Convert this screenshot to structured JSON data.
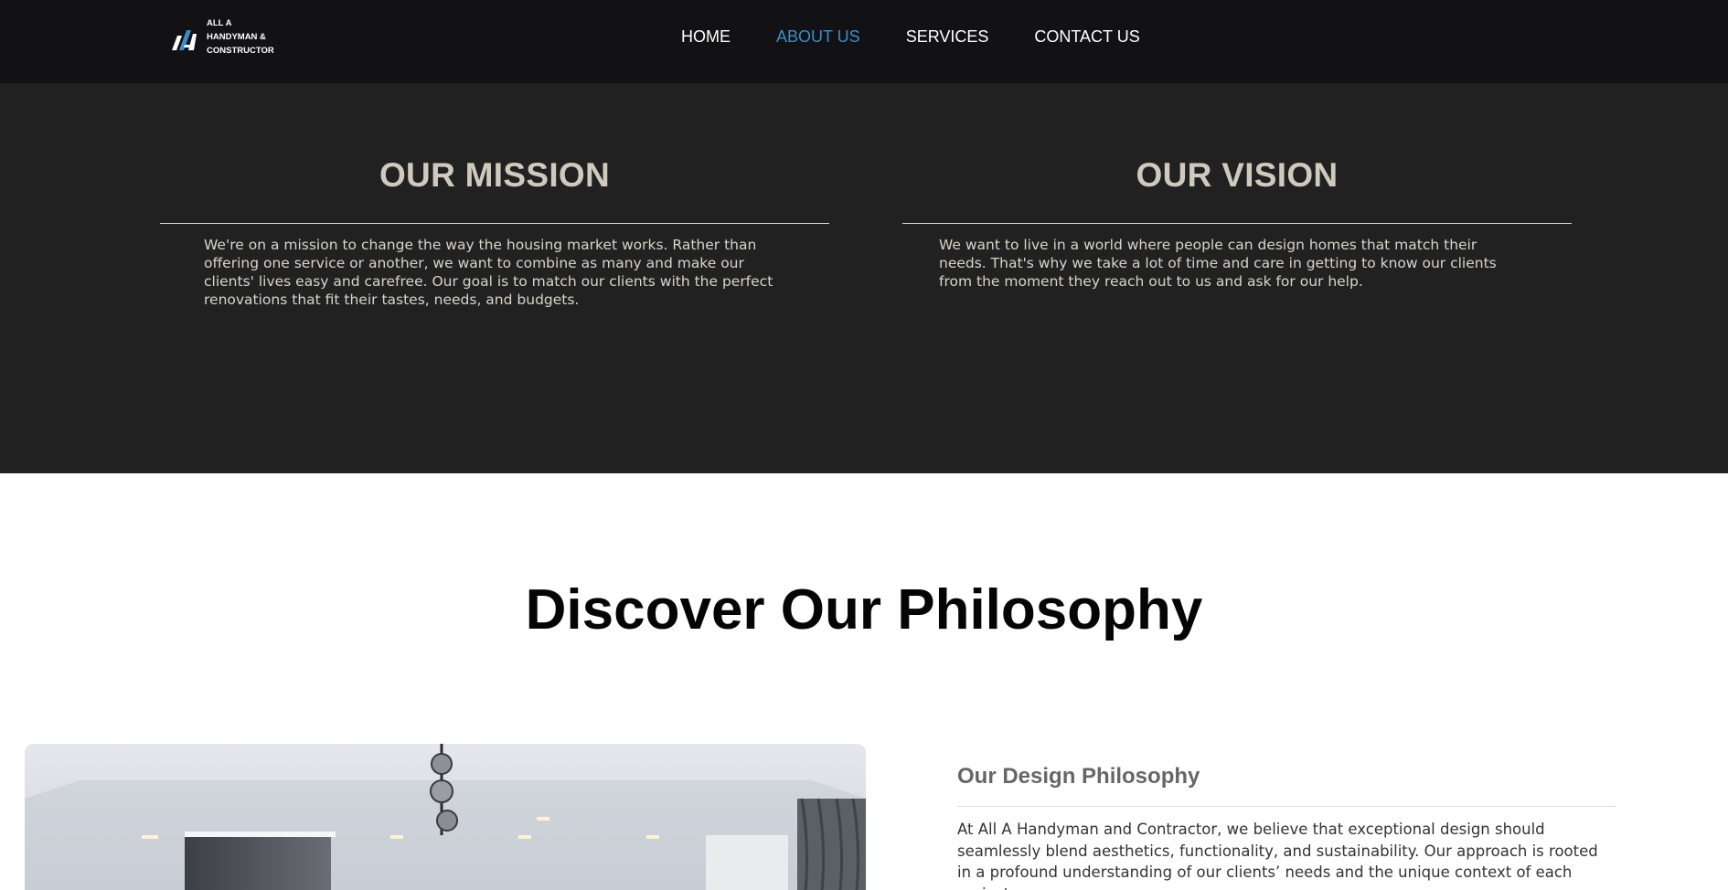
{
  "header": {
    "logo_lines": [
      "ALL A",
      "HANDYMAN &",
      "CONSTRUCTOR"
    ],
    "nav": [
      {
        "label": "HOME",
        "active": false
      },
      {
        "label": "ABOUT US",
        "active": true
      },
      {
        "label": "SERVICES",
        "active": false
      },
      {
        "label": "CONTACT US",
        "active": false
      }
    ]
  },
  "mission": {
    "title": "OUR MISSION",
    "text": "We're on a mission to change the way the housing market works. Rather than offering one service or another, we want to combine as many and make our clients' lives easy and carefree. Our goal is to match our clients with the perfect renovations that fit their tastes, needs, and budgets."
  },
  "vision": {
    "title": "OUR VISION",
    "text": "We want to live in a world where people can design homes that match their needs. That's why we take a lot of time and care in getting to know our clients from the moment they reach out to us and ask for our help."
  },
  "philosophy": {
    "heading": "Discover Our Philosophy",
    "design_title": "Our Design Philosophy",
    "design_text": "At All A Handyman and Contractor, we believe that exceptional design should seamlessly blend aesthetics, functionality, and sustainability. Our approach is rooted in a profound understanding of our clients’ needs and the unique context of each project."
  },
  "colors": {
    "header_bg": "#121214",
    "band_bg": "#212121",
    "nav_active": "#3a8ec9",
    "heading_beige": "#cfcabd",
    "logo_blue": "#3a8ec9"
  }
}
